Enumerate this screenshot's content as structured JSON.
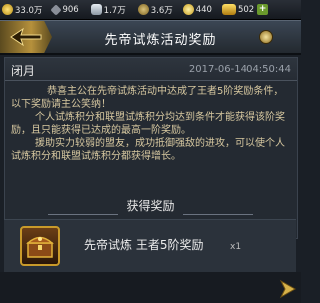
{
  "topbar": {
    "resources": [
      {
        "icon": "gold-coin-icon",
        "value": "33.0万"
      },
      {
        "icon": "weapon-icon",
        "value": "906"
      },
      {
        "icon": "silver-ingot-icon",
        "value": "1.7万"
      },
      {
        "icon": "food-icon",
        "value": "3.6万"
      },
      {
        "icon": "coin-icon",
        "value": "440"
      },
      {
        "icon": "gold-ingot-icon",
        "value": "502"
      }
    ]
  },
  "header": {
    "title": "先帝试炼活动奖励"
  },
  "mail": {
    "sender": "闭月",
    "date": "2017-06-14",
    "time": "04:50:44",
    "paragraphs": [
      "恭喜主公在先帝试炼活动中达成了王者5阶奖励条件，以下奖励请主公笑纳！",
      "个人试炼积分和联盟试炼积分均达到条件才能获得该阶奖励，且只能获得已达成的最高一阶奖励。",
      "援助实力较弱的盟友，成功抵御强敌的进攻，可以使个人试炼积分和联盟试炼积分都获得增长。"
    ]
  },
  "reward": {
    "title": "获得奖励",
    "item_name": "先帝试炼  王者5阶奖励",
    "item_count": "x1"
  },
  "colors": {
    "accent_gold": "#c99a2a",
    "body_text": "#d7c8a0"
  }
}
